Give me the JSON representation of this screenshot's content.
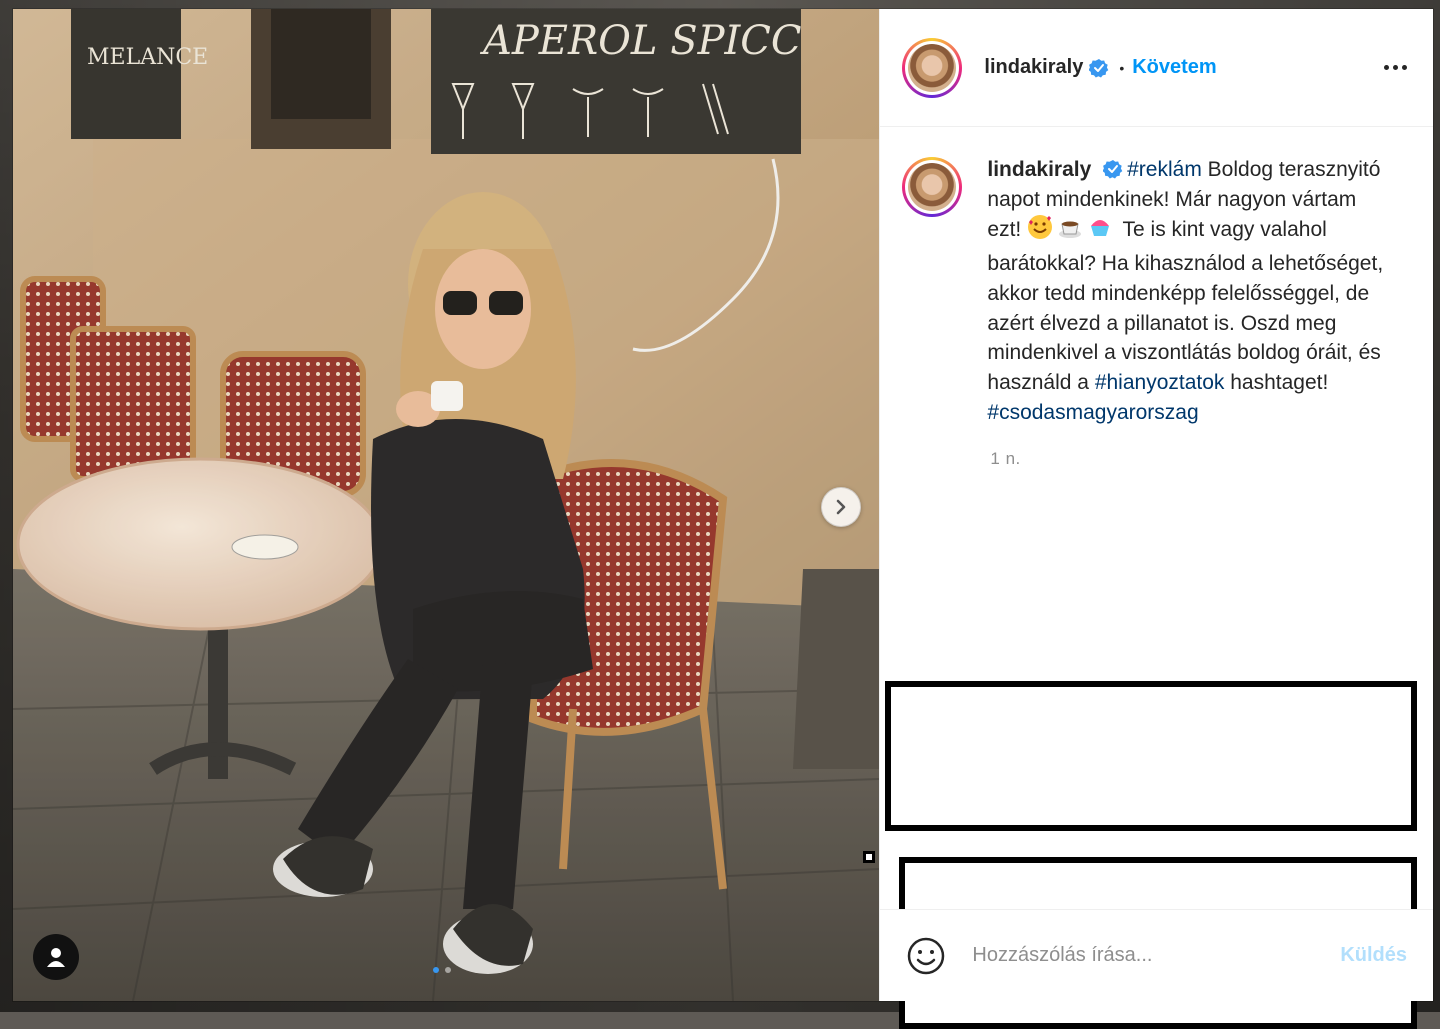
{
  "post": {
    "username": "lindakiraly",
    "follow_label": "Követem",
    "bullet": "•",
    "caption": {
      "username": "lindakiraly",
      "tag1": "#reklám",
      "text1": " Boldog terasznyitó napot mindenkinek! Már nagyon vártam ezt! ",
      "emoji1": "smiling-face-with-hearts",
      "emoji2": "hot-beverage",
      "emoji3": "shaved-ice",
      "text2": " Te is kint vagy valahol barátokkal? Ha kihasználod a lehetőséget, akkor tedd mindenképp felelősséggel, de azért élvezd a pillanatot is. Oszd meg mindenkivel a viszontlátás boldog óráit, és használd a ",
      "tag2": "#hianyoztatok",
      "text3": " hashtaget! ",
      "tag3": "#csodasmagyarorszag"
    },
    "time": "1 n.",
    "carousel": {
      "total": 2,
      "active": 0
    }
  },
  "comment": {
    "placeholder": "Hozzászólás írása...",
    "send_label": "Küldés"
  },
  "photo_text": {
    "sign_main": "APEROL SPICC",
    "sign_side": "MELANCE"
  },
  "colors": {
    "accent": "#0095f6",
    "hashtag": "#00376b",
    "text": "#262626",
    "muted": "#8e8e8e",
    "send_disabled": "#b2dffc"
  }
}
